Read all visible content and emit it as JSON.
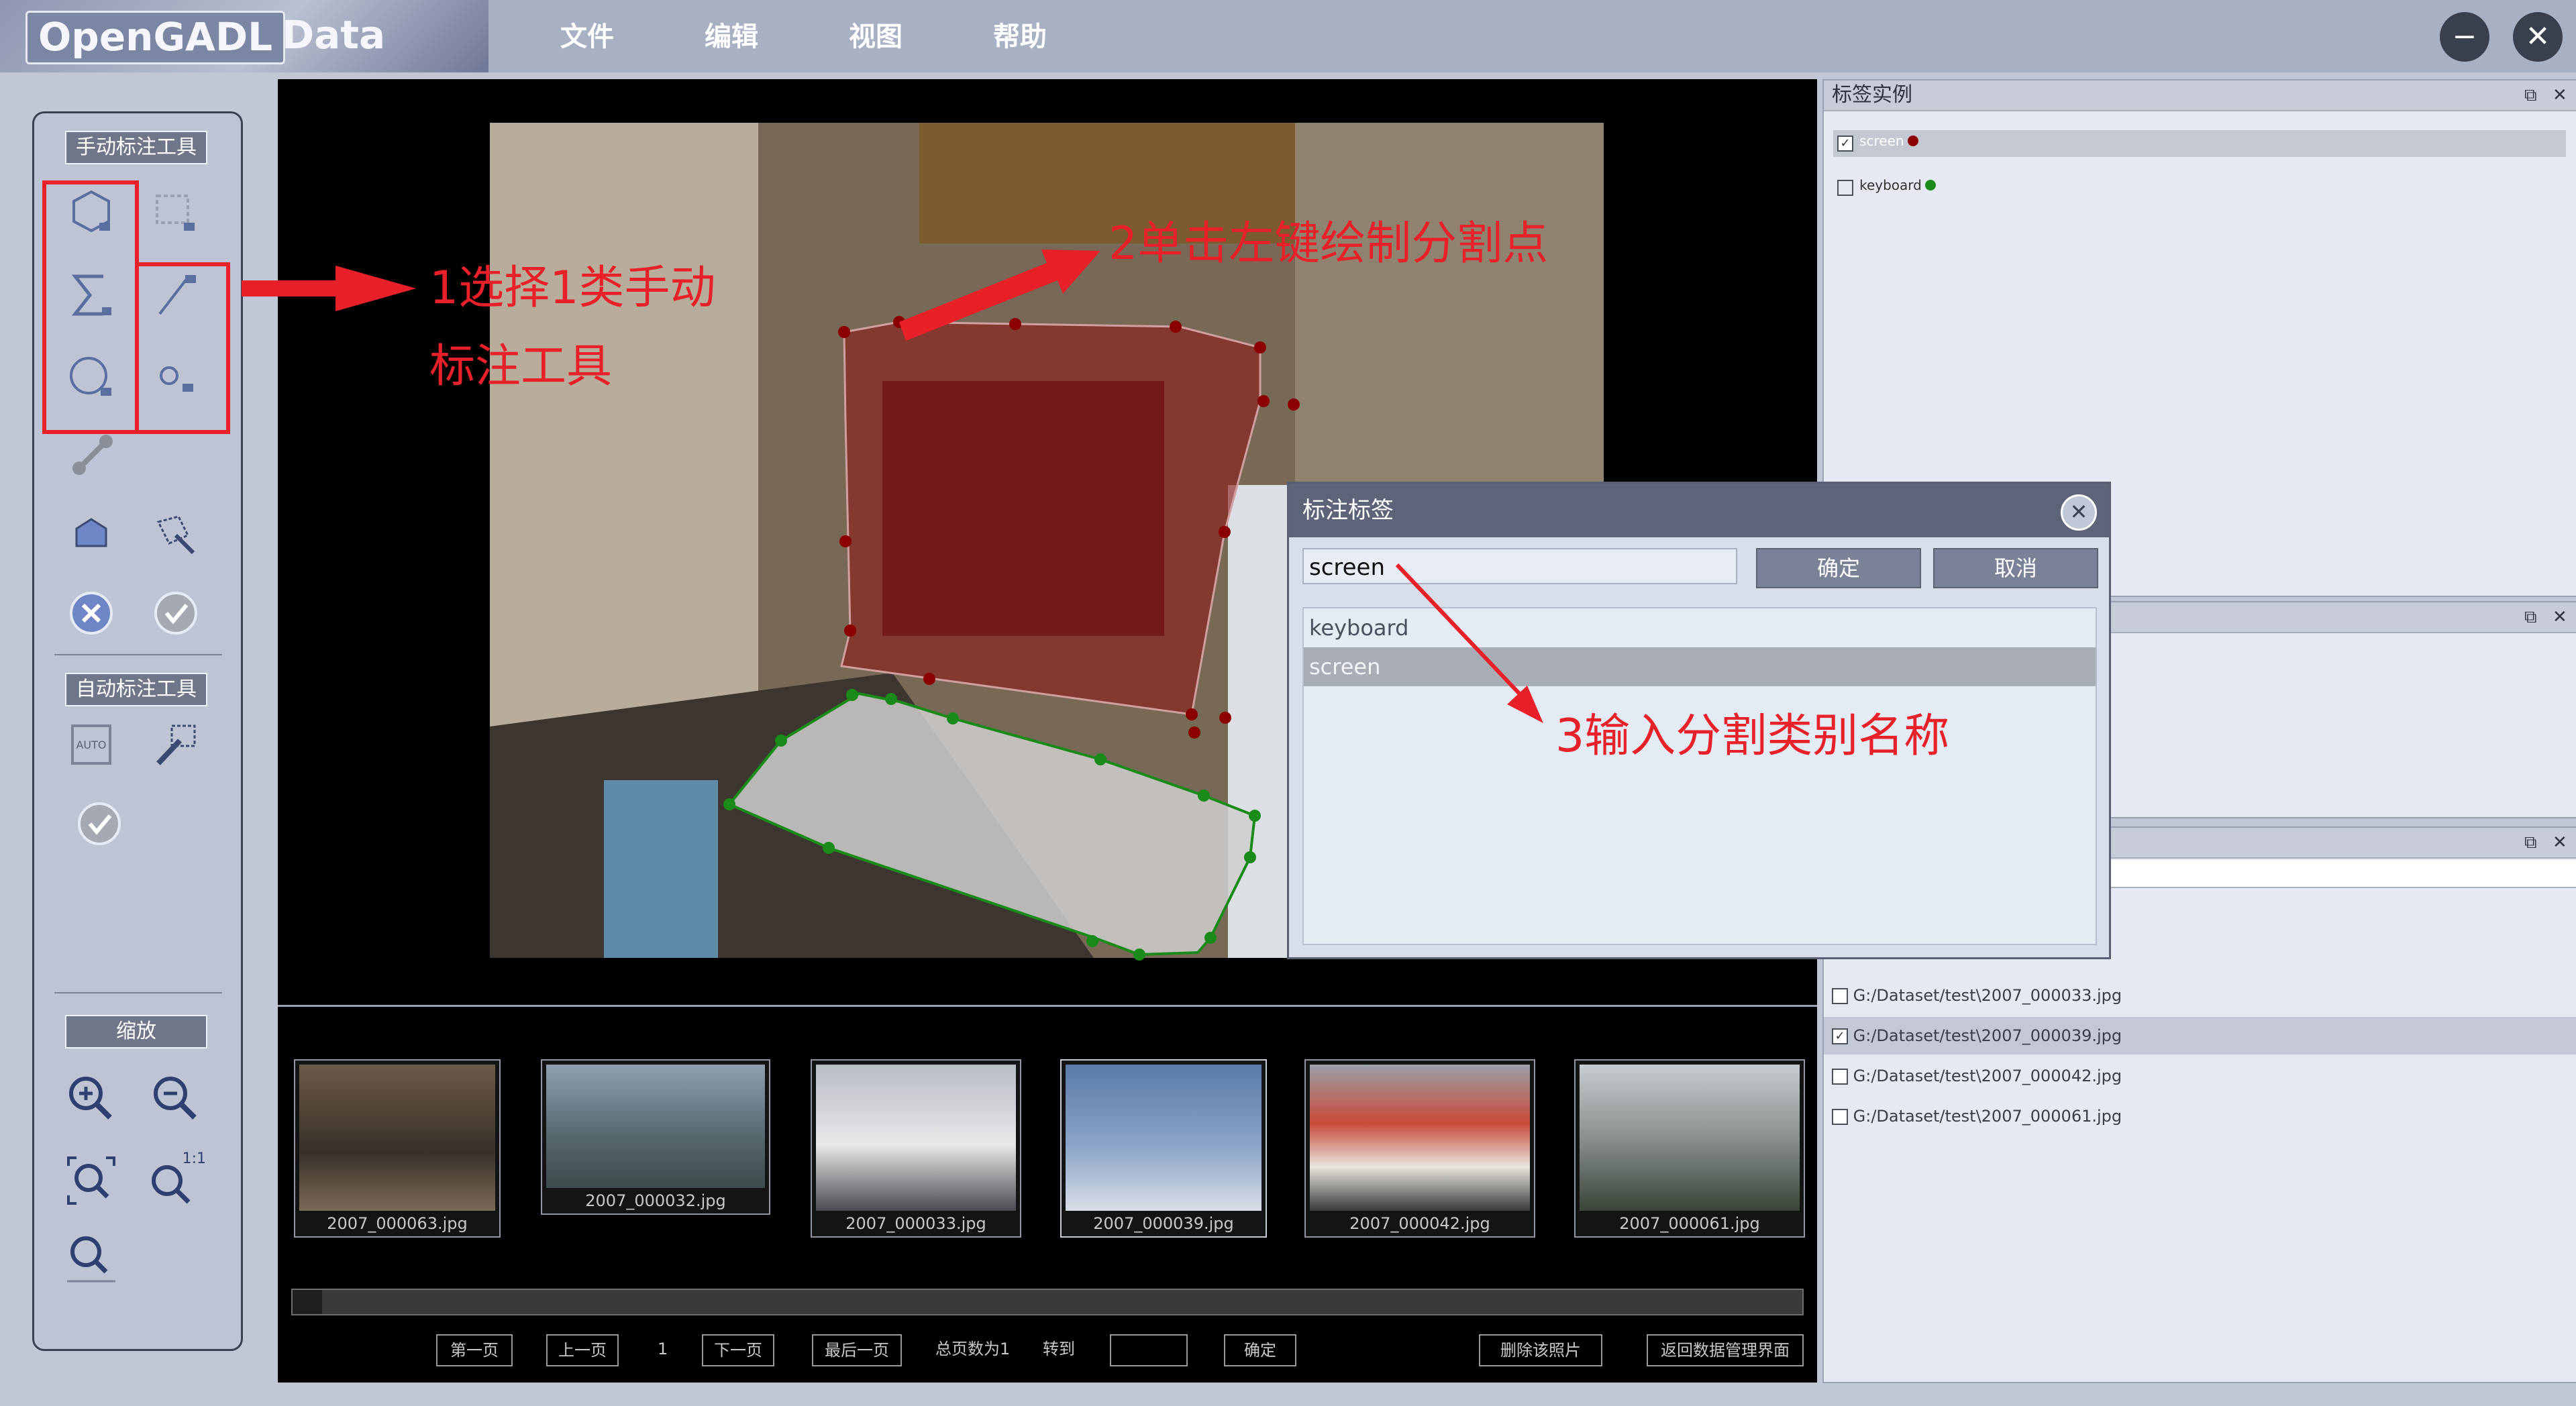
{
  "app": {
    "logo": "OpenGADL",
    "logo_suffix": "Data",
    "menu": [
      "文件",
      "编辑",
      "视图",
      "帮助"
    ],
    "minimize_glyph": "−",
    "close_glyph": "✕"
  },
  "toolbar": {
    "manual_title": "手动标注工具",
    "auto_title": "自动标注工具",
    "zoom_title": "缩放",
    "zoom_ratio": "1:1"
  },
  "annotations": {
    "step1_line1": "1选择1类手动",
    "step1_line2": "标注工具",
    "step2": "2单击左键绘制分割点",
    "step3": "3输入分割类别名称"
  },
  "dialog": {
    "title": "标注标签",
    "input_value": "screen",
    "ok_label": "确定",
    "cancel_label": "取消",
    "options": [
      "keyboard",
      "screen"
    ],
    "selected_option": "screen"
  },
  "right_panels": {
    "labels_title": "标签实例",
    "labels": [
      {
        "name": "screen",
        "checked": true,
        "color": "#8b0000"
      },
      {
        "name": "keyboard",
        "checked": false,
        "color": "#1a8a1a"
      }
    ],
    "files": [
      {
        "path": "G:/Dataset/test\\2007_000033.jpg",
        "checked": false
      },
      {
        "path": "G:/Dataset/test\\2007_000039.jpg",
        "checked": true
      },
      {
        "path": "G:/Dataset/test\\2007_000042.jpg",
        "checked": false
      },
      {
        "path": "G:/Dataset/test\\2007_000061.jpg",
        "checked": false
      }
    ]
  },
  "thumbnails": [
    "2007_000063.jpg",
    "2007_000032.jpg",
    "2007_000033.jpg",
    "2007_000039.jpg",
    "2007_000042.jpg",
    "2007_000061.jpg"
  ],
  "pager": {
    "first": "第一页",
    "prev": "上一页",
    "page": "1",
    "next": "下一页",
    "last": "最后一页",
    "total": "总页数为1",
    "goto": "转到",
    "confirm": "确定",
    "delete": "删除该照片",
    "back": "返回数据管理界面"
  },
  "colors": {
    "accent_red": "#e8202a",
    "screen_polygon": "#8b0000",
    "keyboard_polygon": "#1a8a1a"
  }
}
